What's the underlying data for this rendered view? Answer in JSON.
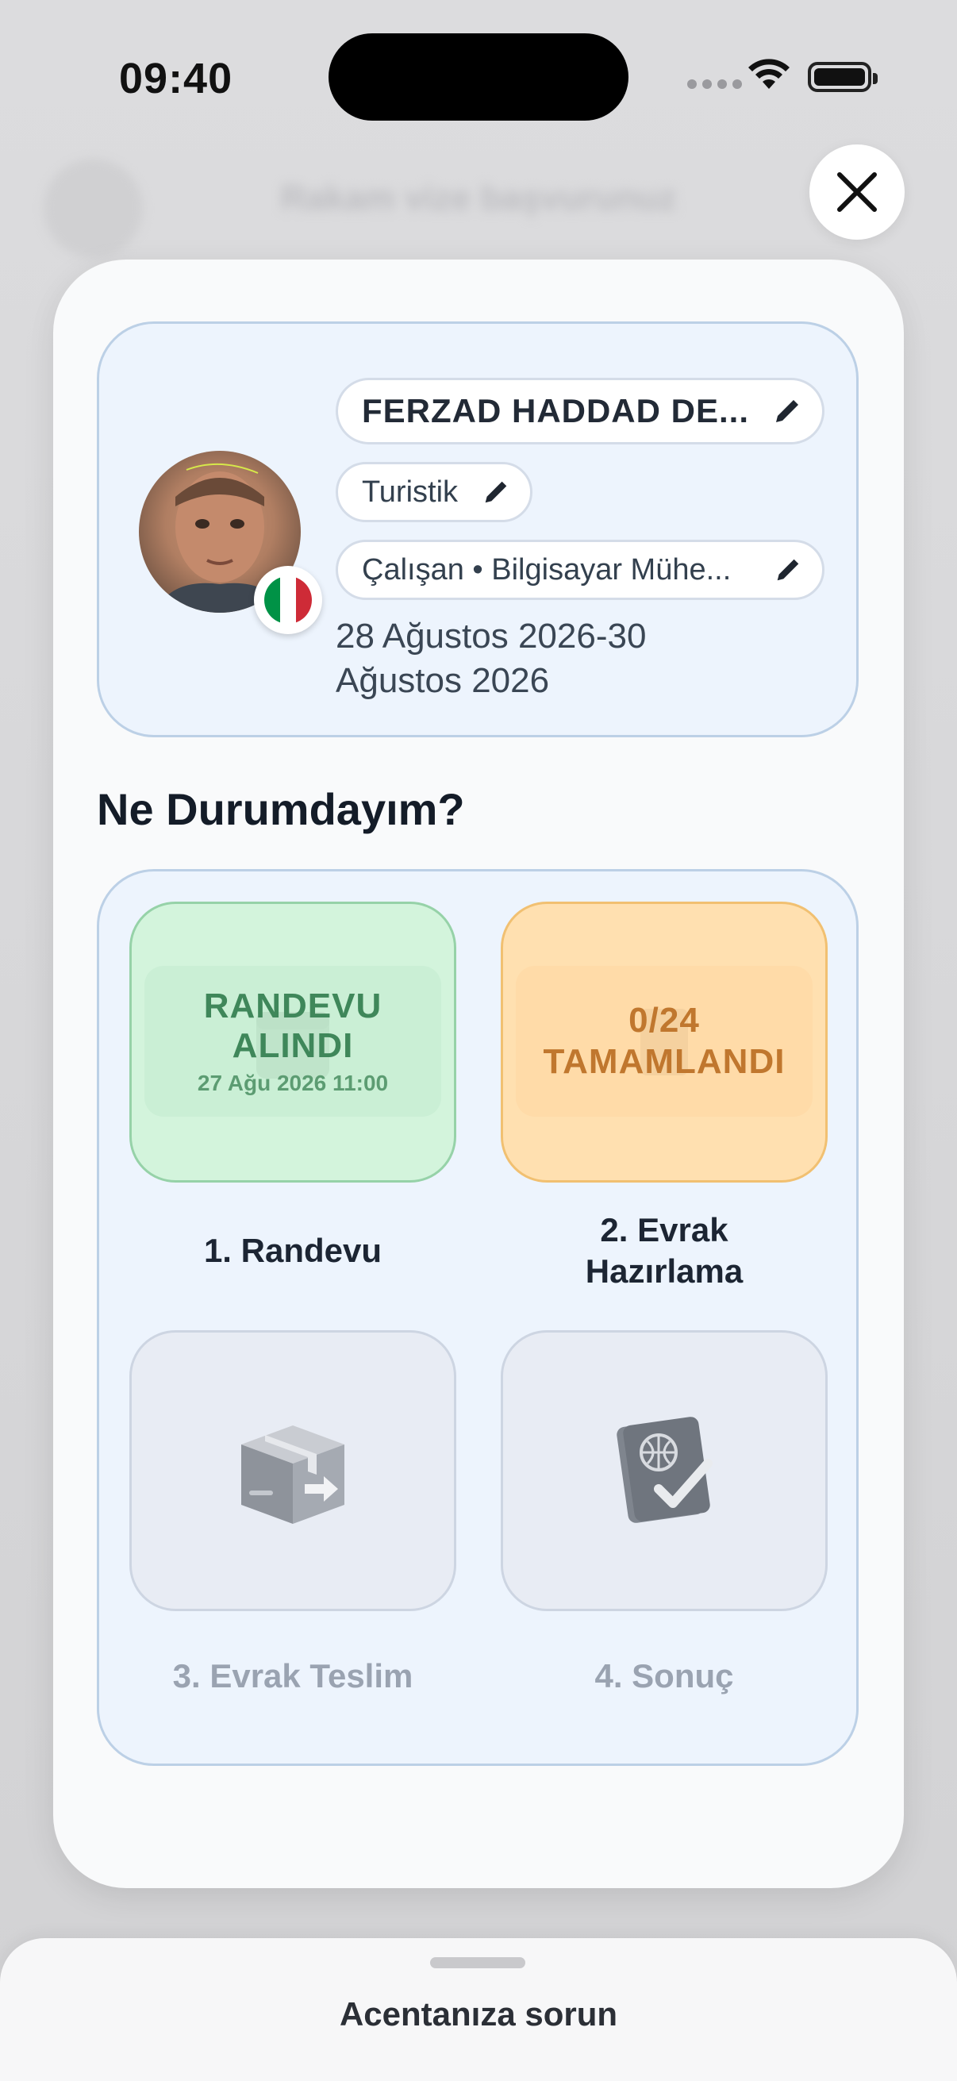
{
  "status_bar": {
    "time": "09:40"
  },
  "background": {
    "title": "Rakam vize başvurunuz"
  },
  "profile": {
    "name": "FERZAD HADDAD DE...",
    "visa_type": "Turistik",
    "occupation": "Çalışan • Bilgisayar Mühe...",
    "dates": "28 Ağustos 2026-30 Ağustos 2026",
    "flag_colors": [
      "#009246",
      "#ffffff",
      "#ce2b37"
    ]
  },
  "section_title": "Ne Durumdayım?",
  "steps": [
    {
      "label": "1. Randevu",
      "status_main": "RANDEVU ALINDI",
      "status_sub": "27 Ağu 2026 11:00",
      "icon": "calendar-icon"
    },
    {
      "label": "2. Evrak Hazırlama",
      "status_main": "0/24 TAMAMLANDI",
      "icon": "documents-icon"
    },
    {
      "label": "3. Evrak Teslim",
      "icon": "package-icon"
    },
    {
      "label": "4. Sonuç",
      "icon": "passport-icon"
    }
  ],
  "bottom": {
    "ask_label": "Acentanıza sorun"
  },
  "colors": {
    "done_green": "#3f875a",
    "progress_orange": "#c0772e",
    "inactive_gray": "#9aa3b1"
  }
}
